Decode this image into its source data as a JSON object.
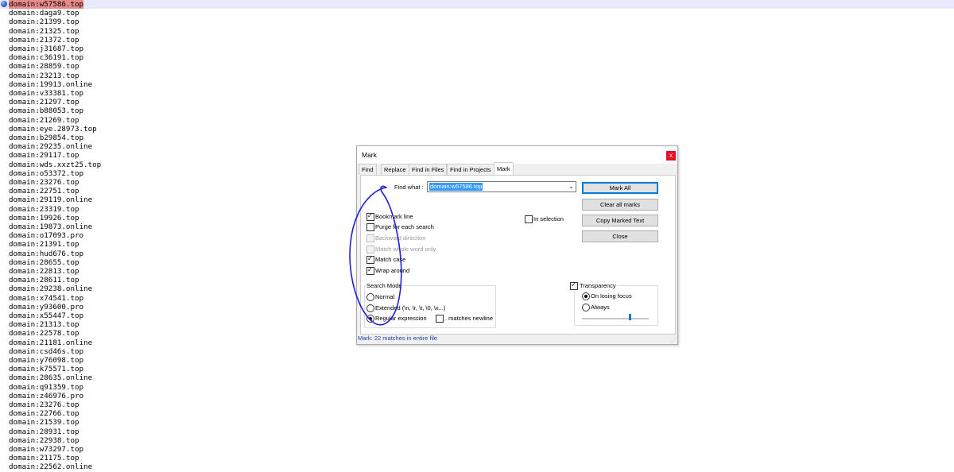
{
  "editor": {
    "lines": [
      "domain:w57586.top",
      "domain:daga9.top",
      "domain:21399.top",
      "domain:21325.top",
      "domain:21372.top",
      "domain:j31687.top",
      "domain:c36191.top",
      "domain:28859.top",
      "domain:23213.top",
      "domain:19913.online",
      "domain:v33381.top",
      "domain:21297.top",
      "domain:b88053.top",
      "domain:21269.top",
      "domain:eye.28973.top",
      "domain:b29854.top",
      "domain:29235.online",
      "domain:29117.top",
      "domain:wds.xxzt25.top",
      "domain:o53372.top",
      "domain:23276.top",
      "domain:22751.top",
      "domain:29119.online",
      "domain:23319.top",
      "domain:19926.top",
      "domain:19873.online",
      "domain:o17093.pro",
      "domain:21391.top",
      "domain:hud676.top",
      "domain:28655.top",
      "domain:22813.top",
      "domain:28611.top",
      "domain:29238.online",
      "domain:x74541.top",
      "domain:y93600.pro",
      "domain:x55447.top",
      "domain:21313.top",
      "domain:22578.top",
      "domain:21181.online",
      "domain:csd46s.top",
      "domain:y76098.top",
      "domain:k75571.top",
      "domain:28635.online",
      "domain:q91359.top",
      "domain:z46976.pro",
      "domain:23276.top",
      "domain:22766.top",
      "domain:21539.top",
      "domain:28931.top",
      "domain:22938.top",
      "domain:w73297.top",
      "domain:21175.top",
      "domain:22562.online"
    ]
  },
  "dialog": {
    "title": "Mark",
    "close_label": "x",
    "tabs": [
      "Find",
      "Replace",
      "Find in Files",
      "Find in Projects",
      "Mark"
    ],
    "find_what_label": "Find what :",
    "find_what_value": "domain:w57586.top",
    "buttons": {
      "mark_all": "Mark All",
      "clear_all_marks": "Clear all marks",
      "copy_marked_text": "Copy Marked Text",
      "close": "Close"
    },
    "options": {
      "bookmark_line": "Bookmark line",
      "purge": "Purge for each search",
      "backward": "Backward direction",
      "whole_word": "Match whole word only",
      "match_case": "Match case",
      "wrap_around": "Wrap around",
      "in_selection": "In selection"
    },
    "search_mode": {
      "title": "Search Mode",
      "normal": "Normal",
      "extended": "Extended (\\n, \\r, \\t, \\0, \\x...)",
      "regex": "Regular expression",
      "matches_newline": ". matches newline"
    },
    "transparency": {
      "title": "Transparency",
      "on_losing_focus": "On losing focus",
      "always": "Always",
      "level": 0.72
    },
    "status": "Mark: 22 matches in entire file"
  },
  "colors": {
    "current_line": "#e8e8ff",
    "match_highlight": "#e88a8a",
    "annotation": "#1f1fd6",
    "status_text": "#1a3ea8"
  }
}
